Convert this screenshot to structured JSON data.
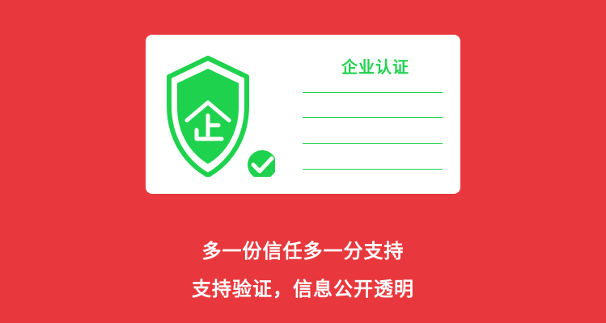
{
  "card": {
    "title": "企业认证",
    "icon": "shield-check-icon",
    "accent_color": "#1fd24e"
  },
  "captions": {
    "line1": "多一份信任多一分支持",
    "line2": "支持验证，信息公开透明"
  },
  "colors": {
    "background": "#e8383d",
    "card": "#ffffff",
    "caption_text": "#ffffff"
  }
}
